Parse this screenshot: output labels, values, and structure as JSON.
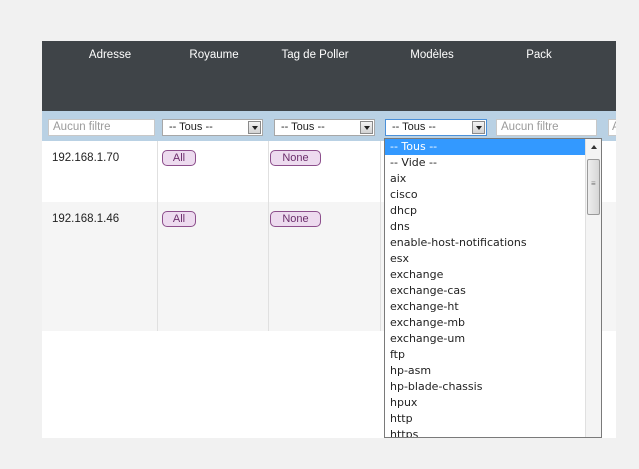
{
  "table": {
    "headers": {
      "adresse": "Adresse",
      "royaume": "Royaume",
      "tag_poller": "Tag de Poller",
      "modeles": "Modèles",
      "pack": "Pack"
    },
    "filters": {
      "left_text": "Aucun filtre",
      "royaume": "-- Tous --",
      "tag_poller": "-- Tous --",
      "modeles": "-- Tous --",
      "pack": "Aucun filtre",
      "right_partial": "A"
    },
    "rows": [
      {
        "address": "192.168.1.70",
        "royaume": "All",
        "tag_poller": "None"
      },
      {
        "address": "192.168.1.46",
        "royaume": "All",
        "tag_poller": "None"
      }
    ]
  },
  "dropdown": {
    "selected": "-- Tous --",
    "options": [
      "-- Tous --",
      "-- Vide --",
      "aix",
      "cisco",
      "dhcp",
      "dns",
      "enable-host-notifications",
      "esx",
      "exchange",
      "exchange-cas",
      "exchange-ht",
      "exchange-mb",
      "exchange-um",
      "ftp",
      "hp-asm",
      "hp-blade-chassis",
      "hpux",
      "http",
      "https"
    ]
  }
}
